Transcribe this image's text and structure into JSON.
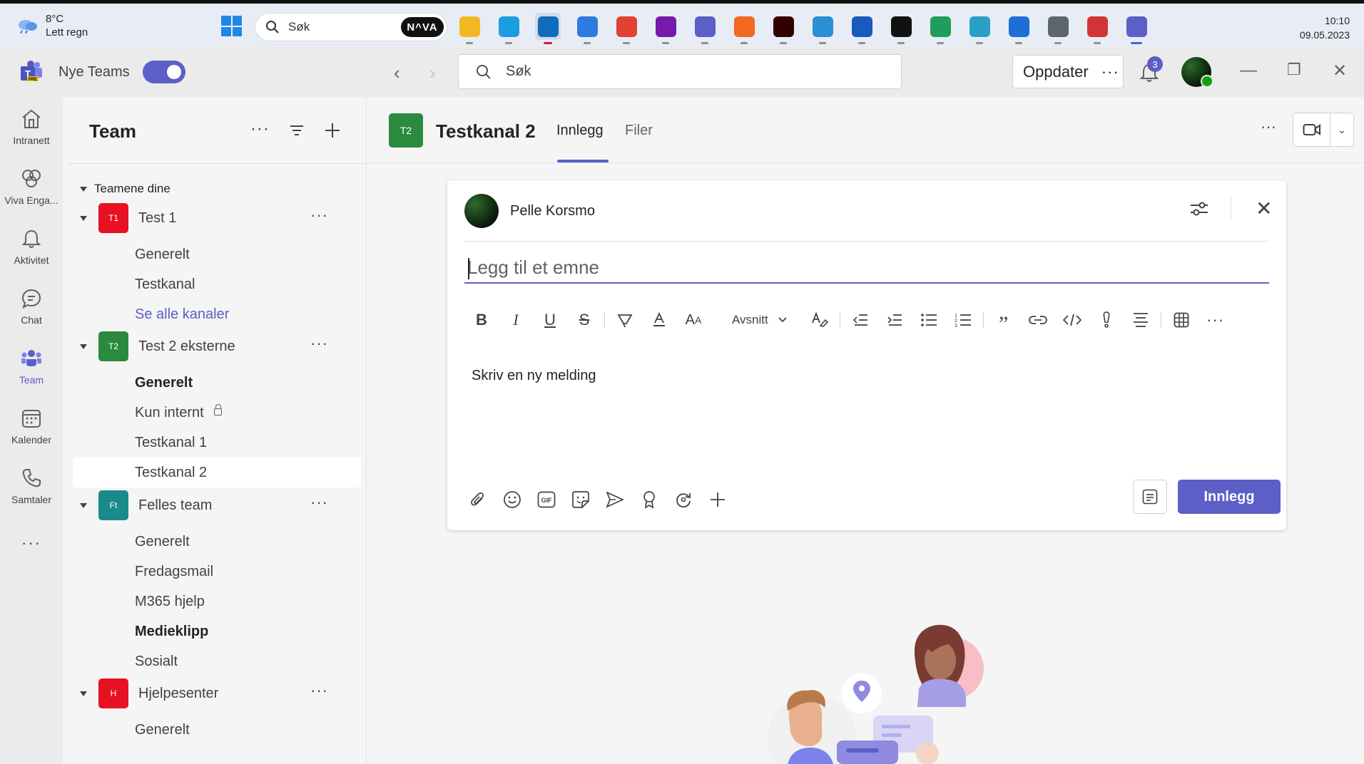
{
  "taskbar": {
    "weather_temp": "8°C",
    "weather_desc": "Lett regn",
    "search_placeholder": "Søk",
    "nova_label": "N^VA",
    "apps": [
      {
        "name": "file-explorer-icon",
        "color": "#f2b823"
      },
      {
        "name": "edge-profile-icon",
        "color": "#1b9de2"
      },
      {
        "name": "outlook-icon",
        "color": "#0f6cbd",
        "active": true
      },
      {
        "name": "mail-icon",
        "color": "#2f7be0"
      },
      {
        "name": "chrome-icon",
        "color": "#e34133"
      },
      {
        "name": "onenote-icon",
        "color": "#7719aa"
      },
      {
        "name": "teams-classic-icon",
        "color": "#5b5fc7"
      },
      {
        "name": "fusion360-icon",
        "color": "#f26722"
      },
      {
        "name": "illustrator-icon",
        "color": "#330000"
      },
      {
        "name": "powershell-icon",
        "color": "#2a8fd4"
      },
      {
        "name": "word-icon",
        "color": "#185abd"
      },
      {
        "name": "app-black-icon",
        "color": "#111111"
      },
      {
        "name": "edge-dev-icon",
        "color": "#1f9e5b"
      },
      {
        "name": "edge-beta-icon",
        "color": "#2aa0c9"
      },
      {
        "name": "window-app-icon",
        "color": "#1e6fd4"
      },
      {
        "name": "settings-icon",
        "color": "#5c6670"
      },
      {
        "name": "snipping-tool-icon",
        "color": "#d13438"
      },
      {
        "name": "teams-preview-icon",
        "color": "#5b5fc7",
        "active2": true
      }
    ],
    "time": "10:10",
    "date": "09.05.2023"
  },
  "titlebar": {
    "app_name": "Nye Teams",
    "search_placeholder": "Søk",
    "update_label": "Oppdater",
    "notification_count": "3"
  },
  "rail": {
    "items": [
      {
        "label": "Intranett"
      },
      {
        "label": "Viva Enga..."
      },
      {
        "label": "Aktivitet"
      },
      {
        "label": "Chat"
      },
      {
        "label": "Team"
      },
      {
        "label": "Kalender"
      },
      {
        "label": "Samtaler"
      }
    ]
  },
  "pane": {
    "title": "Team",
    "section": "Teamene dine",
    "teams": [
      {
        "tile": "T1",
        "name": "Test 1",
        "color": "#e81123",
        "channels": [
          "Generelt",
          "Testkanal",
          "Se alle kanaler"
        ]
      },
      {
        "tile": "T2",
        "name": "Test 2 eksterne",
        "color": "#2a8a3e",
        "channels": [
          "Generelt",
          "Kun internt",
          "Testkanal 1",
          "Testkanal 2"
        ]
      },
      {
        "tile": "Ft",
        "name": "Felles team",
        "color": "#1b8a8a",
        "channels": [
          "Generelt",
          "Fredagsmail",
          "M365 hjelp",
          "Medieklipp",
          "Sosialt"
        ]
      },
      {
        "tile": "H",
        "name": "Hjelpesenter",
        "color": "#e81123",
        "channels": [
          "Generelt"
        ]
      }
    ]
  },
  "channel": {
    "tile": "T2",
    "title": "Testkanal 2",
    "tabs": [
      "Innlegg",
      "Filer"
    ]
  },
  "composer": {
    "author": "Pelle Korsmo",
    "subject_placeholder": "Legg til et emne",
    "paragraph_style": "Avsnitt",
    "body_placeholder": "Skriv en ny melding",
    "post_label": "Innlegg"
  }
}
